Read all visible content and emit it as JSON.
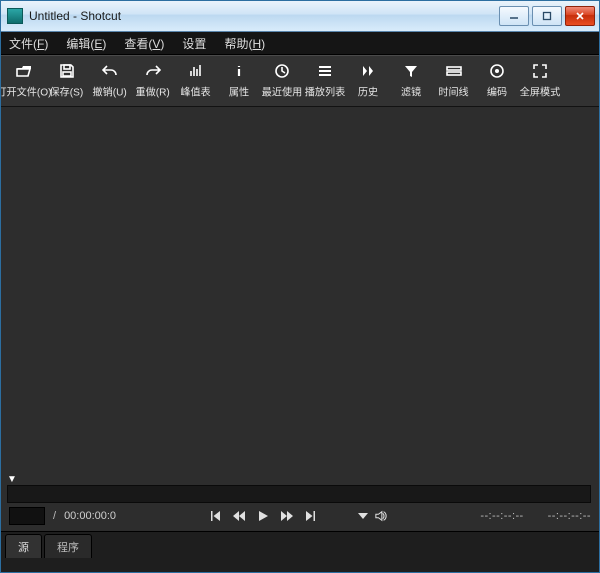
{
  "window": {
    "title": "Untitled - Shotcut"
  },
  "menubar": {
    "file": {
      "label": "文件",
      "hotkey": "F"
    },
    "edit": {
      "label": "编辑",
      "hotkey": "E"
    },
    "view": {
      "label": "查看",
      "hotkey": "V"
    },
    "settings": {
      "label": "设置"
    },
    "help": {
      "label": "帮助",
      "hotkey": "H"
    }
  },
  "toolbar": {
    "open": {
      "label": "打开文件(O)"
    },
    "save": {
      "label": "保存(S)"
    },
    "undo": {
      "label": "撤销(U)"
    },
    "redo": {
      "label": "重做(R)"
    },
    "peak": {
      "label": "峰值表"
    },
    "props": {
      "label": "属性"
    },
    "recent": {
      "label": "最近使用"
    },
    "playlist": {
      "label": "播放列表"
    },
    "history": {
      "label": "历史"
    },
    "filters": {
      "label": "滤镜"
    },
    "timeline": {
      "label": "时间线"
    },
    "encode": {
      "label": "编码"
    },
    "fullscreen": {
      "label": "全屏模式"
    }
  },
  "transport": {
    "separator": "/",
    "duration": "00:00:00:0",
    "readout_left": "--:--:--:--",
    "readout_right": "--:--:--:--"
  },
  "tabs": {
    "source": {
      "label": "源"
    },
    "program": {
      "label": "程序"
    }
  }
}
